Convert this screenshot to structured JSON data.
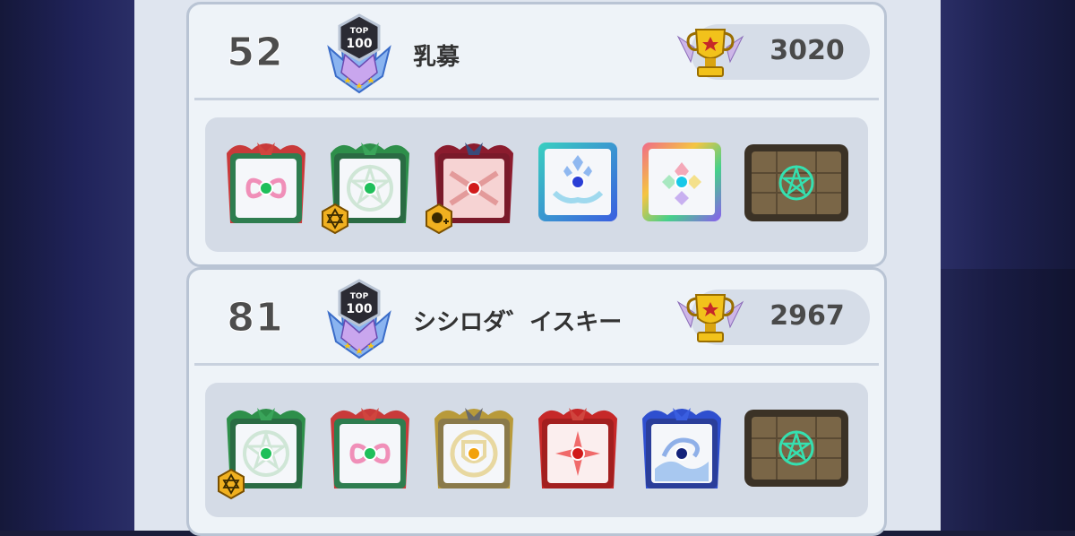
{
  "entries": [
    {
      "rank": "52",
      "player": "乳募",
      "rank_badge_top": "TOP",
      "rank_badge_num": "100",
      "score": "3020",
      "slots": [
        {
          "icon": "rainbow-infinity-card-icon",
          "frame": "#c93a3a",
          "inner": "#2e7d4f",
          "pip": null
        },
        {
          "icon": "green-pentagram-card-icon",
          "frame": "#2e8f4a",
          "inner": "#2a6b43",
          "pip": "hexagram-badge-icon"
        },
        {
          "icon": "red-swords-card-icon",
          "frame": "#8b1c2e",
          "inner": "#7a1a2a",
          "pip": "skull-plus-badge-icon"
        },
        {
          "icon": "blue-hands-card-icon",
          "frame": "#39d0c0",
          "inner": "#2d63d9",
          "pip": null
        },
        {
          "icon": "rainbow-diamonds-card-icon",
          "frame": "#f06a8a",
          "inner": "#8a5cf0",
          "pip": null
        },
        {
          "icon": "stone-pentagram-tile-icon",
          "frame": "#3b3226",
          "inner": "#6b5a3f",
          "pip": null
        }
      ]
    },
    {
      "rank": "81",
      "player": "シシロダ゛イスキー",
      "rank_badge_top": "TOP",
      "rank_badge_num": "100",
      "score": "2967",
      "slots": [
        {
          "icon": "green-pentagram-card-icon",
          "frame": "#2e8f4a",
          "inner": "#2a6b43",
          "pip": "hexagram-badge-icon"
        },
        {
          "icon": "rainbow-infinity-card-icon",
          "frame": "#c93a3a",
          "inner": "#2e7d4f",
          "pip": null
        },
        {
          "icon": "gold-shield-card-icon",
          "frame": "#b89a3a",
          "inner": "#8a7a4a",
          "pip": null
        },
        {
          "icon": "red-star-card-icon",
          "frame": "#c62828",
          "inner": "#a31f1f",
          "pip": null
        },
        {
          "icon": "blue-wave-card-icon",
          "frame": "#2f4fcf",
          "inner": "#2a3e9a",
          "pip": null
        },
        {
          "icon": "stone-pentagram-tile-icon",
          "frame": "#3b3226",
          "inner": "#6b5a3f",
          "pip": null
        }
      ]
    }
  ],
  "colors": {
    "green_dot": "#1fbf5a",
    "red_dot": "#d11a1a",
    "blue_dot": "#2b3fd6",
    "cyan_dot": "#18c8e8",
    "orange_dot": "#f2a20c",
    "navy_dot": "#14237a"
  }
}
